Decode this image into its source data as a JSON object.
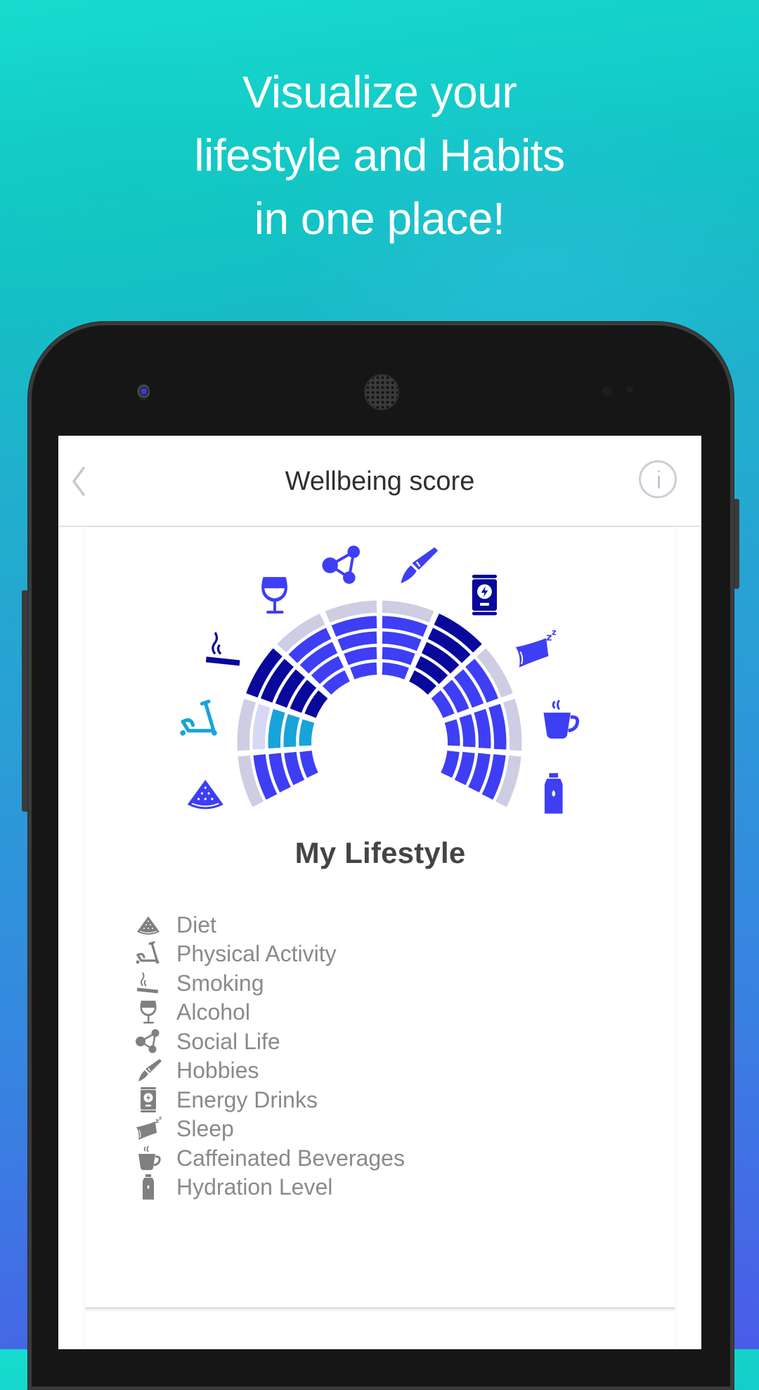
{
  "promo": {
    "headline_lines": [
      "Visualize your",
      "lifestyle and Habits",
      "in one place!"
    ]
  },
  "appbar": {
    "title": "Wellbeing score",
    "back_icon": "chevron-left-icon",
    "info_icon": "info-icon"
  },
  "colors": {
    "good": "#3e3ef5",
    "excellent_dark": "#08089a",
    "physical": "#17a4d8",
    "partial": "#d7d7f6",
    "empty": "#cdcde3",
    "legend_icon": "#808080",
    "legend_text": "#8a8a8a",
    "title_text": "#444444"
  },
  "section": {
    "title": "My Lifestyle"
  },
  "chart_data": {
    "type": "radial-bar",
    "title": "My Lifestyle",
    "max_value": 5,
    "categories": [
      "Diet",
      "Physical Activity",
      "Smoking",
      "Alcohol",
      "Social Life",
      "Hobbies",
      "Energy Drinks",
      "Sleep",
      "Caffeinated Beverages",
      "Hydration Level"
    ],
    "values": [
      4,
      3.5,
      5,
      4,
      4,
      4,
      5,
      4,
      4,
      4
    ],
    "series_color_keys": [
      "good",
      "physical",
      "excellent_dark",
      "good",
      "good",
      "good",
      "excellent_dark",
      "good",
      "good",
      "good"
    ],
    "icons": [
      "watermelon-icon",
      "scooter-icon",
      "cigarette-icon",
      "wine-glass-icon",
      "share-network-icon",
      "paintbrush-icon",
      "energy-drink-icon",
      "pillow-sleep-icon",
      "coffee-cup-icon",
      "water-bottle-icon"
    ]
  },
  "legend": [
    {
      "label": "Diet",
      "icon": "watermelon-icon"
    },
    {
      "label": "Physical Activity",
      "icon": "scooter-icon"
    },
    {
      "label": "Smoking",
      "icon": "cigarette-icon"
    },
    {
      "label": "Alcohol",
      "icon": "wine-glass-icon"
    },
    {
      "label": "Social Life",
      "icon": "share-network-icon"
    },
    {
      "label": "Hobbies",
      "icon": "paintbrush-icon"
    },
    {
      "label": "Energy Drinks",
      "icon": "energy-drink-icon"
    },
    {
      "label": "Sleep",
      "icon": "pillow-sleep-icon"
    },
    {
      "label": "Caffeinated Beverages",
      "icon": "coffee-cup-icon"
    },
    {
      "label": "Hydration Level",
      "icon": "water-bottle-icon"
    }
  ]
}
